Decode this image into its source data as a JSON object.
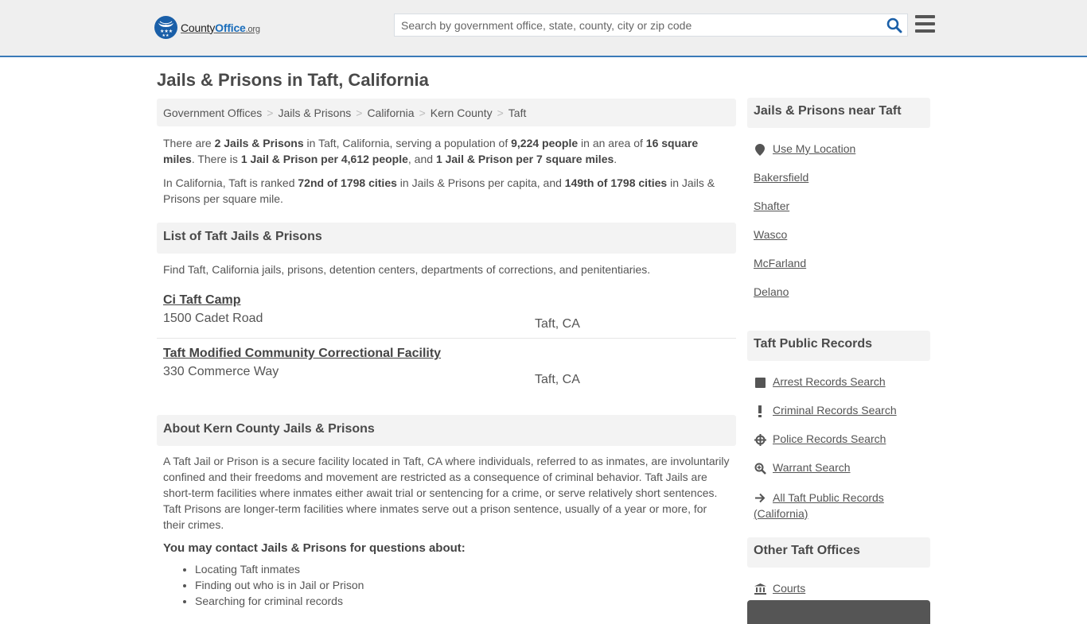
{
  "header": {
    "logo": {
      "county": "County",
      "office": "Office",
      "org": ".org"
    },
    "search_placeholder": "Search by government office, state, county, city or zip code",
    "search_icon": "search-icon",
    "menu_icon": "hamburger-menu-icon",
    "accent_color": "#3a7ab8"
  },
  "page_title": "Jails & Prisons in Taft, California",
  "breadcrumb": [
    "Government Offices",
    "Jails & Prisons",
    "California",
    "Kern County",
    "Taft"
  ],
  "intro": {
    "p1": [
      {
        "t": "There are ",
        "b": false
      },
      {
        "t": "2 Jails & Prisons",
        "b": true
      },
      {
        "t": " in Taft, California, serving a population of ",
        "b": false
      },
      {
        "t": "9,224 people",
        "b": true
      },
      {
        "t": " in an area of ",
        "b": false
      },
      {
        "t": "16 square miles",
        "b": true
      },
      {
        "t": ". There is ",
        "b": false
      },
      {
        "t": "1 Jail & Prison per 4,612 people",
        "b": true
      },
      {
        "t": ", and ",
        "b": false
      },
      {
        "t": "1 Jail & Prison per 7 square miles",
        "b": true
      },
      {
        "t": ".",
        "b": false
      }
    ],
    "p2": [
      {
        "t": "In California, Taft is ranked ",
        "b": false
      },
      {
        "t": "72nd of 1798 cities",
        "b": true
      },
      {
        "t": " in Jails & Prisons per capita, and ",
        "b": false
      },
      {
        "t": "149th of 1798 cities",
        "b": true
      },
      {
        "t": " in Jails & Prisons per square mile.",
        "b": false
      }
    ]
  },
  "list_section": {
    "title": "List of Taft Jails & Prisons",
    "description": "Find Taft, California jails, prisons, detention centers, departments of corrections, and penitentiaries.",
    "items": [
      {
        "name": "Ci Taft Camp",
        "address": "1500 Cadet Road",
        "city": "Taft, CA"
      },
      {
        "name": "Taft Modified Community Correctional Facility",
        "address": "330 Commerce Way",
        "city": "Taft, CA"
      }
    ]
  },
  "about_section": {
    "title": "About Kern County Jails & Prisons",
    "text": "A Taft Jail or Prison is a secure facility located in Taft, CA where individuals, referred to as inmates, are involuntarily confined and their freedoms and movement are restricted as a consequence of criminal behavior. Taft Jails are short-term facilities where inmates either await trial or sentencing for a crime, or serve relatively short sentences. Taft Prisons are longer-term facilities where inmates serve out a prison sentence, usually of a year or more, for their crimes.",
    "contact_heading": "You may contact Jails & Prisons for questions about:",
    "contact_items": [
      "Locating Taft inmates",
      "Finding out who is in Jail or Prison",
      "Searching for criminal records"
    ]
  },
  "sidebar": {
    "near": {
      "title": "Jails & Prisons near Taft",
      "use_location": {
        "label": "Use My Location",
        "icon": "map-marker-icon"
      },
      "cities": [
        "Bakersfield",
        "Shafter",
        "Wasco",
        "McFarland",
        "Delano"
      ]
    },
    "public_records": {
      "title": "Taft Public Records",
      "items": [
        {
          "label": "Arrest Records Search",
          "icon": "square-icon"
        },
        {
          "label": "Criminal Records Search",
          "icon": "exclamation-icon"
        },
        {
          "label": "Police Records Search",
          "icon": "crosshairs-icon"
        },
        {
          "label": "Warrant Search",
          "icon": "search-plus-icon"
        },
        {
          "label": "All Taft Public Records (California)",
          "icon": "arrow-right-icon"
        }
      ]
    },
    "other_offices": {
      "title": "Other Taft Offices",
      "items": [
        {
          "label": "Courts",
          "icon": "courthouse-icon"
        }
      ]
    }
  }
}
